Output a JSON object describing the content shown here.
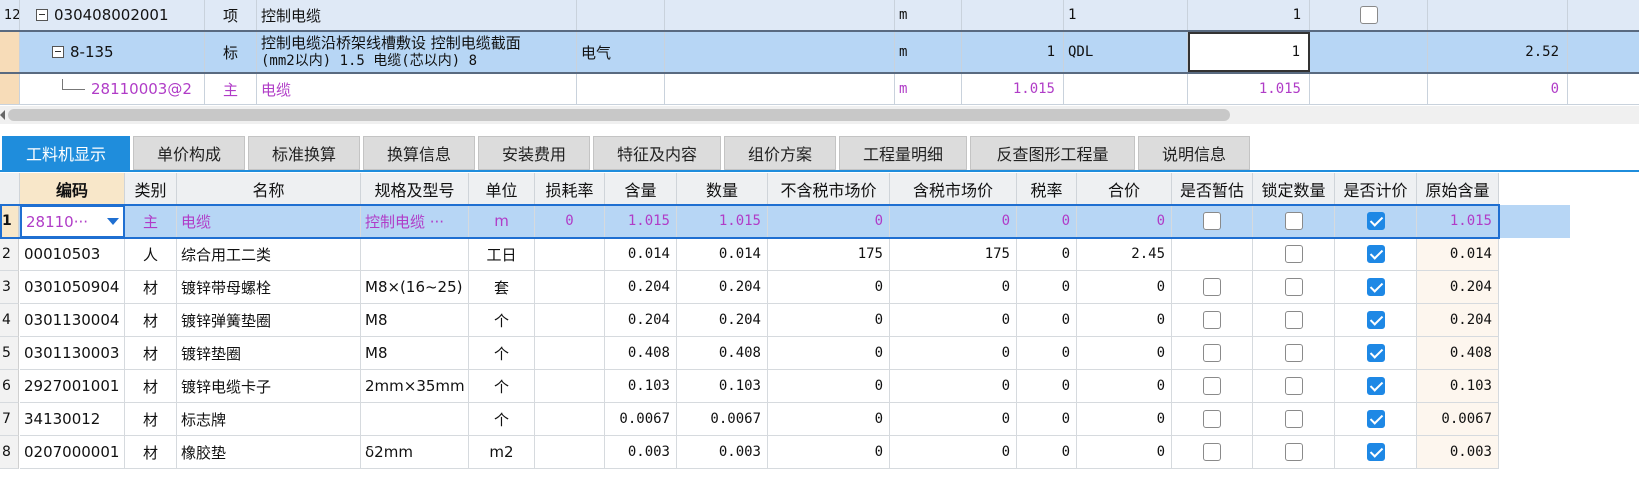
{
  "tree_rows": [
    {
      "rownum": "12",
      "code": "030408002001",
      "type": "项",
      "name": "控制电缆",
      "specialty": "",
      "unit": "m",
      "qty": "",
      "expr": "1",
      "amount": "1",
      "checkbox": false,
      "price": ""
    },
    {
      "code": "8-135",
      "type": "标",
      "name_line1": "控制电缆沿桥架线槽敷设 控制电缆截面",
      "name_line2": "(mm2以内) 1.5 电缆(芯以内) 8",
      "specialty": "电气",
      "unit": "m",
      "qty": "1",
      "expr": "QDL",
      "amount": "1",
      "price": "2.52"
    },
    {
      "code": "28110003@2",
      "type": "主",
      "name": "电缆",
      "unit": "m",
      "qty": "1.015",
      "amount": "1.015",
      "price": "0"
    }
  ],
  "tabs": [
    "工料机显示",
    "单价构成",
    "标准换算",
    "换算信息",
    "安装费用",
    "特征及内容",
    "组价方案",
    "工程量明细",
    "反查图形工程量",
    "说明信息"
  ],
  "columns": [
    "编码",
    "类别",
    "名称",
    "规格及型号",
    "单位",
    "损耗率",
    "含量",
    "数量",
    "不含税市场价",
    "含税市场价",
    "税率",
    "合价",
    "是否暂估",
    "锁定数量",
    "是否计价",
    "原始含量"
  ],
  "rows": [
    {
      "n": "1",
      "code": "28110···",
      "cat": "主",
      "name": "电缆",
      "spec": "控制电缆 ···",
      "unit": "m",
      "loss": "0",
      "content": "1.015",
      "qty": "1.015",
      "price_ex": "0",
      "price_in": "0",
      "tax": "0",
      "total": "0",
      "est": false,
      "lock": false,
      "priced": true,
      "orig": "1.015"
    },
    {
      "n": "2",
      "code": "00010503",
      "cat": "人",
      "name": "综合用工二类",
      "spec": "",
      "unit": "工日",
      "loss": "",
      "content": "0.014",
      "qty": "0.014",
      "price_ex": "175",
      "price_in": "175",
      "tax": "0",
      "total": "2.45",
      "est": null,
      "lock": false,
      "priced": true,
      "orig": "0.014"
    },
    {
      "n": "3",
      "code": "0301050904",
      "cat": "材",
      "name": "镀锌带母螺栓",
      "spec": "M8×(16~25)",
      "unit": "套",
      "loss": "",
      "content": "0.204",
      "qty": "0.204",
      "price_ex": "0",
      "price_in": "0",
      "tax": "0",
      "total": "0",
      "est": false,
      "lock": false,
      "priced": true,
      "orig": "0.204"
    },
    {
      "n": "4",
      "code": "0301130004",
      "cat": "材",
      "name": "镀锌弹簧垫圈",
      "spec": "M8",
      "unit": "个",
      "loss": "",
      "content": "0.204",
      "qty": "0.204",
      "price_ex": "0",
      "price_in": "0",
      "tax": "0",
      "total": "0",
      "est": false,
      "lock": false,
      "priced": true,
      "orig": "0.204"
    },
    {
      "n": "5",
      "code": "0301130003",
      "cat": "材",
      "name": "镀锌垫圈",
      "spec": "M8",
      "unit": "个",
      "loss": "",
      "content": "0.408",
      "qty": "0.408",
      "price_ex": "0",
      "price_in": "0",
      "tax": "0",
      "total": "0",
      "est": false,
      "lock": false,
      "priced": true,
      "orig": "0.408"
    },
    {
      "n": "6",
      "code": "2927001001",
      "cat": "材",
      "name": "镀锌电缆卡子",
      "spec": "2mm×35mm",
      "unit": "个",
      "loss": "",
      "content": "0.103",
      "qty": "0.103",
      "price_ex": "0",
      "price_in": "0",
      "tax": "0",
      "total": "0",
      "est": false,
      "lock": false,
      "priced": true,
      "orig": "0.103"
    },
    {
      "n": "7",
      "code": "34130012",
      "cat": "材",
      "name": "标志牌",
      "spec": "",
      "unit": "个",
      "loss": "",
      "content": "0.0067",
      "qty": "0.0067",
      "price_ex": "0",
      "price_in": "0",
      "tax": "0",
      "total": "0",
      "est": false,
      "lock": false,
      "priced": true,
      "orig": "0.0067"
    },
    {
      "n": "8",
      "code": "0207000001",
      "cat": "材",
      "name": "橡胶垫",
      "spec": "δ2mm",
      "unit": "m2",
      "loss": "",
      "content": "0.003",
      "qty": "0.003",
      "price_ex": "0",
      "price_in": "0",
      "tax": "0",
      "total": "0",
      "est": false,
      "lock": false,
      "priced": true,
      "orig": "0.003"
    }
  ],
  "colors": {
    "accent": "#1f8ddc",
    "selection": "#b7d6f5",
    "purple": "#b03cc7",
    "check": "#1e88e5"
  }
}
